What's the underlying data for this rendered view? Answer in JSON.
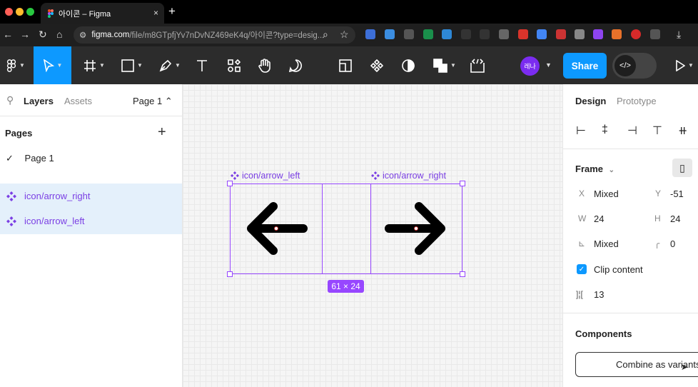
{
  "browser": {
    "tab_title": "아이콘 – Figma",
    "tab_close": "×",
    "new_tab": "+",
    "url_domain": "figma.com",
    "url_path": "/file/m8GTpfjYv7nDvNZ469eK4q/아이콘?type=desig...",
    "traffic_colors": [
      "#ff5f57",
      "#febc2e",
      "#28c840"
    ]
  },
  "toolbar": {
    "avatar_text": "레나",
    "share_label": "Share",
    "dev_mode_label": "</>",
    "accent": "#0d99ff"
  },
  "left_panel": {
    "tabs": [
      "Layers",
      "Assets"
    ],
    "page_selector": "Page 1 ⌃",
    "pages_heading": "Pages",
    "add_page": "+",
    "pages": [
      {
        "check": "✓",
        "label": "Page 1"
      }
    ],
    "layers": [
      {
        "label": "icon/arrow_right"
      },
      {
        "label": "icon/arrow_left"
      }
    ]
  },
  "canvas": {
    "frames": [
      {
        "label": "icon/arrow_left"
      },
      {
        "label": "icon/arrow_right"
      }
    ],
    "selection_size": "61 × 24",
    "selection_color": "#9747ff"
  },
  "right_panel": {
    "tabs": [
      "Design",
      "Prototype"
    ],
    "frame_section": "Frame",
    "x_label": "X",
    "x_value": "Mixed",
    "y_label": "Y",
    "y_value": "-51",
    "w_label": "W",
    "w_value": "24",
    "h_label": "H",
    "h_value": "24",
    "rotation_value": "Mixed",
    "radius_value": "0",
    "clip_content": "Clip content",
    "gap_value": "13",
    "components_heading": "Components",
    "combine_button": "Combine as variants"
  }
}
